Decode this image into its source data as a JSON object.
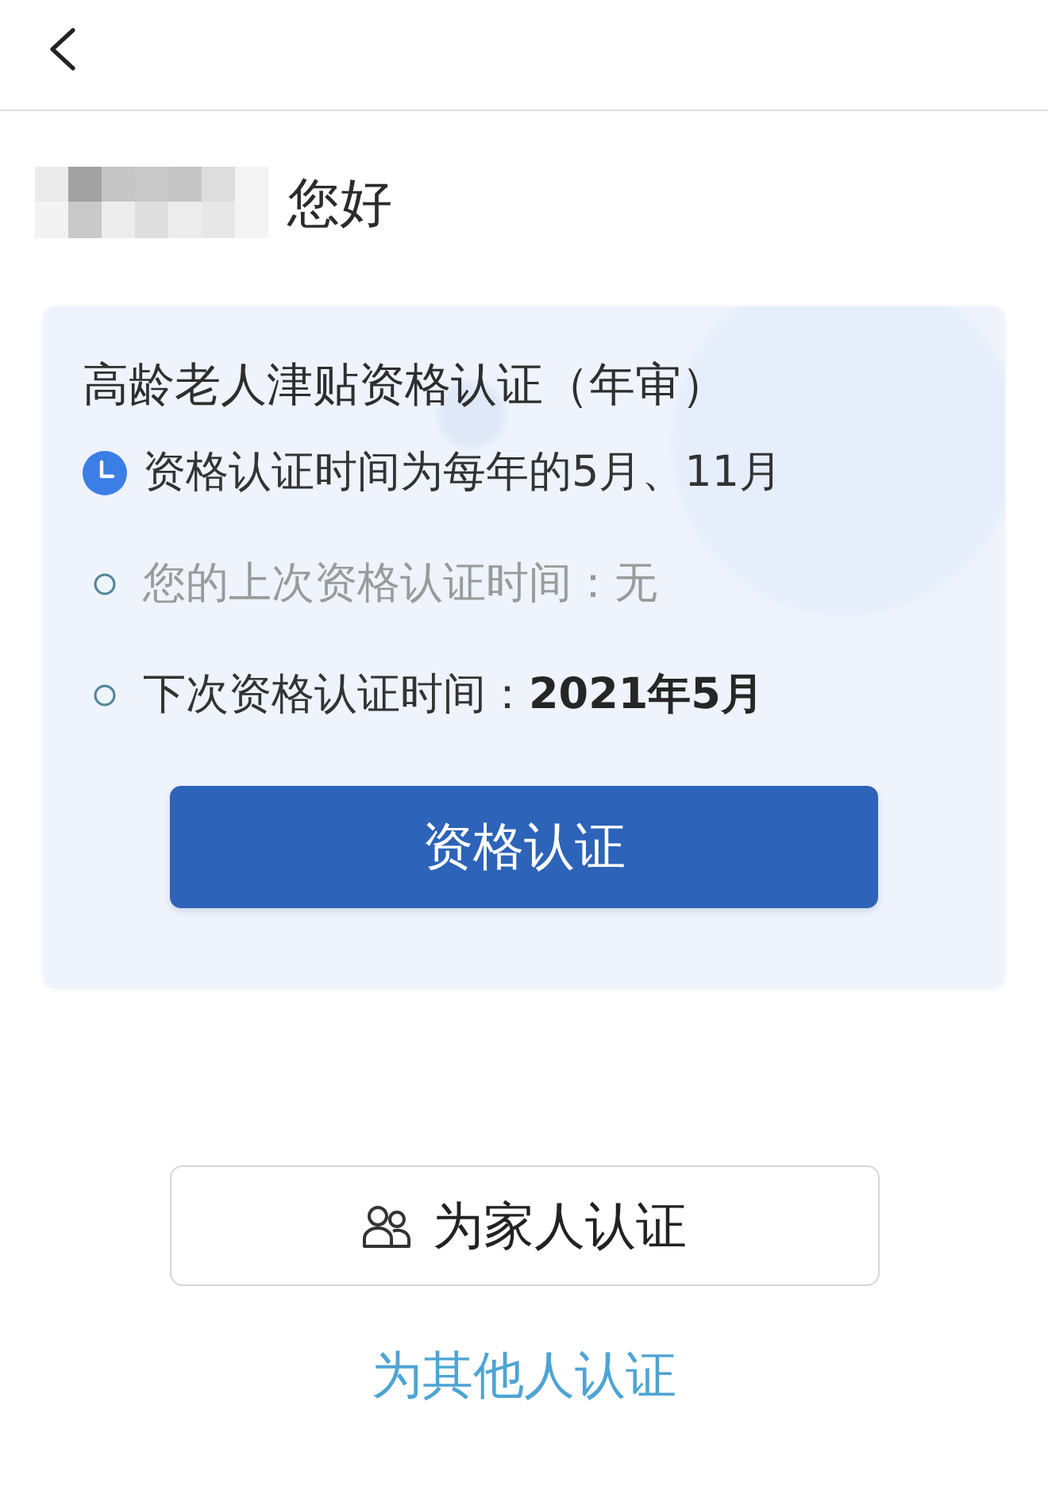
{
  "greeting": {
    "text": "您好"
  },
  "card": {
    "title": "高龄老人津贴资格认证（年审）",
    "items": [
      {
        "kind": "clock",
        "text": "资格认证时间为每年的5月、11月",
        "muted": false
      },
      {
        "kind": "ring",
        "text": "您的上次资格认证时间：无",
        "muted": true
      },
      {
        "kind": "ring",
        "text": "下次资格认证时间：**2021年5月**",
        "muted": false
      }
    ],
    "button": {
      "label": "资格认证"
    }
  },
  "family_button": {
    "label": "为家人认证"
  },
  "others_link": {
    "label": "为其他人认证"
  }
}
